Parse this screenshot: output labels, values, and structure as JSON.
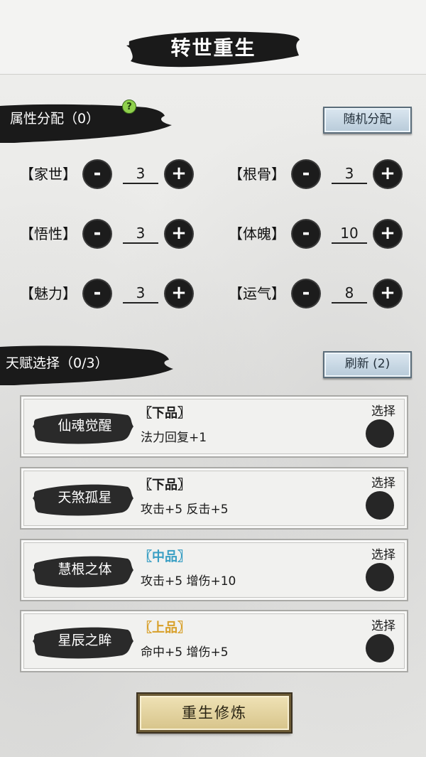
{
  "header": {
    "title": "转世重生"
  },
  "attributes": {
    "title": "属性分配（0）",
    "help_glyph": "?",
    "random_button": "随机分配",
    "minus_glyph": "-",
    "plus_glyph": "+",
    "stats": [
      {
        "label": "【家世】",
        "value": "3"
      },
      {
        "label": "【根骨】",
        "value": "3"
      },
      {
        "label": "【悟性】",
        "value": "3"
      },
      {
        "label": "【体魄】",
        "value": "10"
      },
      {
        "label": "【魅力】",
        "value": "3"
      },
      {
        "label": "【运气】",
        "value": "8"
      }
    ]
  },
  "talents": {
    "title": "天赋选择（0/3）",
    "refresh_button": "刷新 (2)",
    "select_label": "选择",
    "items": [
      {
        "name": "仙魂觉醒",
        "grade": "〖下品〗",
        "effect": "法力回复+1",
        "grade_color": "#1a1a1a"
      },
      {
        "name": "天煞孤星",
        "grade": "〖下品〗",
        "effect": "攻击+5  反击+5",
        "grade_color": "#1a1a1a"
      },
      {
        "name": "慧根之体",
        "grade": "〖中品〗",
        "effect": "攻击+5  增伤+10",
        "grade_color": "#3a9fc4"
      },
      {
        "name": "星辰之眸",
        "grade": "〖上品〗",
        "effect": "命中+5  增伤+5",
        "grade_color": "#d8a02a"
      }
    ]
  },
  "rebirth_button": "重生修炼",
  "colors": {
    "ink": "#1c1c1c",
    "paper": "#e9e9e7",
    "blue_button": "#b7cad9",
    "gold_button": "#d7c48a"
  }
}
